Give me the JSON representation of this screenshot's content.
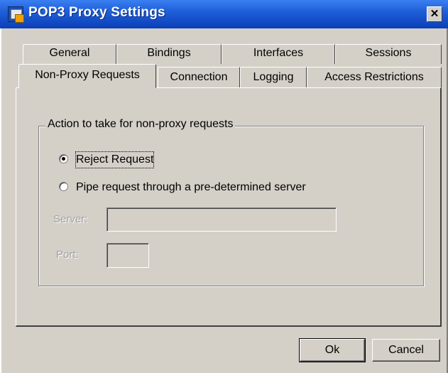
{
  "window": {
    "title": "POP3 Proxy Settings",
    "close_glyph": "✕",
    "app_icon": "proxy-settings-icon"
  },
  "tabs": {
    "row_back": [
      "General",
      "Bindings",
      "Interfaces",
      "Sessions"
    ],
    "row_front": [
      "Non-Proxy Requests",
      "Connection",
      "Logging",
      "Access Restrictions"
    ],
    "active": "Non-Proxy Requests"
  },
  "group": {
    "legend": "Action to take for non-proxy requests"
  },
  "options": {
    "reject_label": "Reject Request",
    "reject_selected": true,
    "pipe_label": "Pipe request through a pre-determined server",
    "pipe_selected": false
  },
  "server_field": {
    "label": "Server:",
    "value": "",
    "enabled": false
  },
  "port_field": {
    "label": "Port:",
    "value": "",
    "enabled": false
  },
  "buttons": {
    "ok_label": "Ok",
    "cancel_label": "Cancel"
  }
}
